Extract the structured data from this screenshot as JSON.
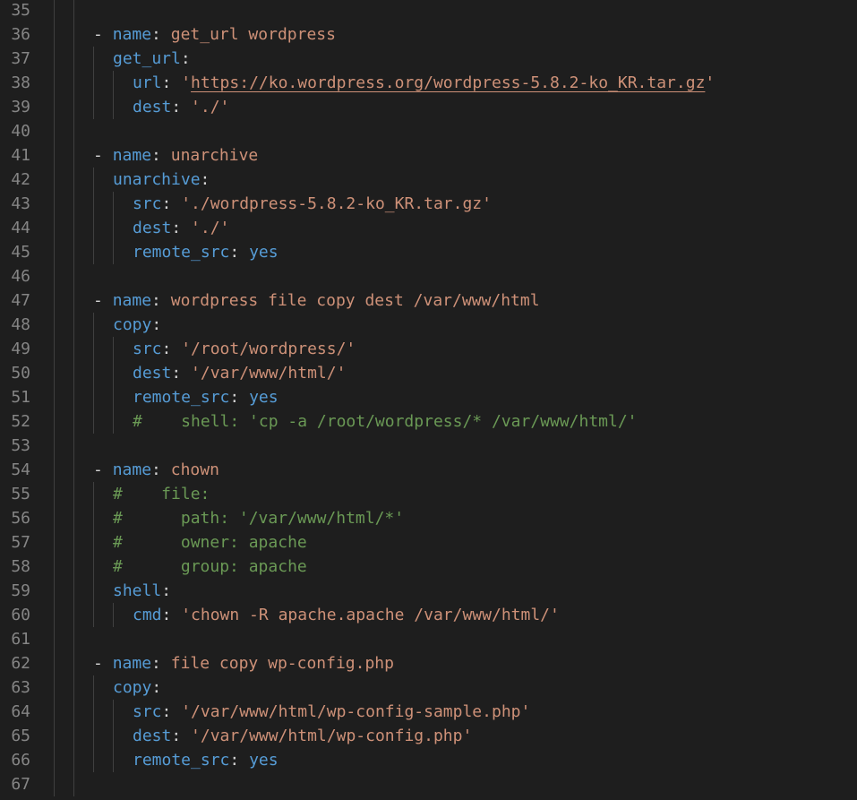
{
  "editor": {
    "language": "yaml",
    "colors": {
      "background": "#1e1e1e",
      "line_number": "#858585",
      "key": "#569cd6",
      "string": "#ce9178",
      "comment": "#6a9955",
      "punctuation": "#d4d4d4"
    },
    "lines": [
      {
        "num": "35",
        "indent": 0,
        "tokens": []
      },
      {
        "num": "36",
        "indent": 1,
        "tokens": [
          {
            "t": "dash",
            "v": "- "
          },
          {
            "t": "key",
            "v": "name"
          },
          {
            "t": "punct",
            "v": ": "
          },
          {
            "t": "str",
            "v": "get_url wordpress"
          }
        ]
      },
      {
        "num": "37",
        "indent": 2,
        "tokens": [
          {
            "t": "key",
            "v": "get_url"
          },
          {
            "t": "punct",
            "v": ":"
          }
        ]
      },
      {
        "num": "38",
        "indent": 3,
        "tokens": [
          {
            "t": "key",
            "v": "url"
          },
          {
            "t": "punct",
            "v": ": "
          },
          {
            "t": "str",
            "v": "'"
          },
          {
            "t": "link",
            "v": "https://ko.wordpress.org/wordpress-5.8.2-ko_KR.tar.gz"
          },
          {
            "t": "str",
            "v": "'"
          }
        ]
      },
      {
        "num": "39",
        "indent": 3,
        "tokens": [
          {
            "t": "key",
            "v": "dest"
          },
          {
            "t": "punct",
            "v": ": "
          },
          {
            "t": "str",
            "v": "'./'"
          }
        ]
      },
      {
        "num": "40",
        "indent": 0,
        "tokens": []
      },
      {
        "num": "41",
        "indent": 1,
        "tokens": [
          {
            "t": "dash",
            "v": "- "
          },
          {
            "t": "key",
            "v": "name"
          },
          {
            "t": "punct",
            "v": ": "
          },
          {
            "t": "str",
            "v": "unarchive"
          }
        ]
      },
      {
        "num": "42",
        "indent": 2,
        "tokens": [
          {
            "t": "key",
            "v": "unarchive"
          },
          {
            "t": "punct",
            "v": ":"
          }
        ]
      },
      {
        "num": "43",
        "indent": 3,
        "tokens": [
          {
            "t": "key",
            "v": "src"
          },
          {
            "t": "punct",
            "v": ": "
          },
          {
            "t": "str",
            "v": "'./wordpress-5.8.2-ko_KR.tar.gz'"
          }
        ]
      },
      {
        "num": "44",
        "indent": 3,
        "tokens": [
          {
            "t": "key",
            "v": "dest"
          },
          {
            "t": "punct",
            "v": ": "
          },
          {
            "t": "str",
            "v": "'./'"
          }
        ]
      },
      {
        "num": "45",
        "indent": 3,
        "tokens": [
          {
            "t": "key",
            "v": "remote_src"
          },
          {
            "t": "punct",
            "v": ": "
          },
          {
            "t": "key",
            "v": "yes"
          }
        ]
      },
      {
        "num": "46",
        "indent": 0,
        "tokens": []
      },
      {
        "num": "47",
        "indent": 1,
        "tokens": [
          {
            "t": "dash",
            "v": "- "
          },
          {
            "t": "key",
            "v": "name"
          },
          {
            "t": "punct",
            "v": ": "
          },
          {
            "t": "str",
            "v": "wordpress file copy dest /var/www/html"
          }
        ]
      },
      {
        "num": "48",
        "indent": 2,
        "tokens": [
          {
            "t": "key",
            "v": "copy"
          },
          {
            "t": "punct",
            "v": ":"
          }
        ]
      },
      {
        "num": "49",
        "indent": 3,
        "tokens": [
          {
            "t": "key",
            "v": "src"
          },
          {
            "t": "punct",
            "v": ": "
          },
          {
            "t": "str",
            "v": "'/root/wordpress/'"
          }
        ]
      },
      {
        "num": "50",
        "indent": 3,
        "tokens": [
          {
            "t": "key",
            "v": "dest"
          },
          {
            "t": "punct",
            "v": ": "
          },
          {
            "t": "str",
            "v": "'/var/www/html/'"
          }
        ]
      },
      {
        "num": "51",
        "indent": 3,
        "tokens": [
          {
            "t": "key",
            "v": "remote_src"
          },
          {
            "t": "punct",
            "v": ": "
          },
          {
            "t": "key",
            "v": "yes"
          }
        ]
      },
      {
        "num": "52",
        "indent": 3,
        "tokens": [
          {
            "t": "comment",
            "v": "#    shell: 'cp -a /root/wordpress/* /var/www/html/'"
          }
        ]
      },
      {
        "num": "53",
        "indent": 0,
        "tokens": []
      },
      {
        "num": "54",
        "indent": 1,
        "tokens": [
          {
            "t": "dash",
            "v": "- "
          },
          {
            "t": "key",
            "v": "name"
          },
          {
            "t": "punct",
            "v": ": "
          },
          {
            "t": "str",
            "v": "chown"
          }
        ]
      },
      {
        "num": "55",
        "indent": 2,
        "tokens": [
          {
            "t": "comment",
            "v": "#    file:"
          }
        ]
      },
      {
        "num": "56",
        "indent": 2,
        "tokens": [
          {
            "t": "comment",
            "v": "#      path: '/var/www/html/*'"
          }
        ]
      },
      {
        "num": "57",
        "indent": 2,
        "tokens": [
          {
            "t": "comment",
            "v": "#      owner: apache"
          }
        ]
      },
      {
        "num": "58",
        "indent": 2,
        "tokens": [
          {
            "t": "comment",
            "v": "#      group: apache"
          }
        ]
      },
      {
        "num": "59",
        "indent": 2,
        "tokens": [
          {
            "t": "key",
            "v": "shell"
          },
          {
            "t": "punct",
            "v": ":"
          }
        ]
      },
      {
        "num": "60",
        "indent": 3,
        "tokens": [
          {
            "t": "key",
            "v": "cmd"
          },
          {
            "t": "punct",
            "v": ": "
          },
          {
            "t": "str",
            "v": "'chown -R apache.apache /var/www/html/'"
          }
        ]
      },
      {
        "num": "61",
        "indent": 0,
        "tokens": []
      },
      {
        "num": "62",
        "indent": 1,
        "tokens": [
          {
            "t": "dash",
            "v": "- "
          },
          {
            "t": "key",
            "v": "name"
          },
          {
            "t": "punct",
            "v": ": "
          },
          {
            "t": "str",
            "v": "file copy wp-config.php"
          }
        ]
      },
      {
        "num": "63",
        "indent": 2,
        "tokens": [
          {
            "t": "key",
            "v": "copy"
          },
          {
            "t": "punct",
            "v": ":"
          }
        ]
      },
      {
        "num": "64",
        "indent": 3,
        "tokens": [
          {
            "t": "key",
            "v": "src"
          },
          {
            "t": "punct",
            "v": ": "
          },
          {
            "t": "str",
            "v": "'/var/www/html/wp-config-sample.php'"
          }
        ]
      },
      {
        "num": "65",
        "indent": 3,
        "tokens": [
          {
            "t": "key",
            "v": "dest"
          },
          {
            "t": "punct",
            "v": ": "
          },
          {
            "t": "str",
            "v": "'/var/www/html/wp-config.php'"
          }
        ]
      },
      {
        "num": "66",
        "indent": 3,
        "tokens": [
          {
            "t": "key",
            "v": "remote_src"
          },
          {
            "t": "punct",
            "v": ": "
          },
          {
            "t": "key",
            "v": "yes"
          }
        ]
      },
      {
        "num": "67",
        "indent": 0,
        "tokens": []
      }
    ]
  }
}
